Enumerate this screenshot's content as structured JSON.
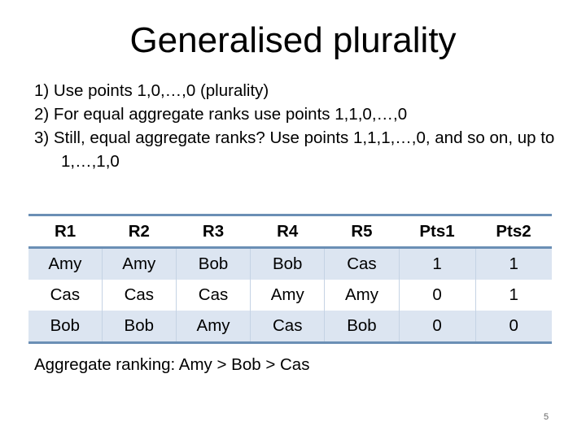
{
  "slide": {
    "title": "Generalised plurality",
    "bullets": [
      "1) Use points 1,0,…,0 (plurality)",
      "2) For equal aggregate ranks use points 1,1,0,…,0",
      "3) Still, equal aggregate ranks? Use points 1,1,1,…,0, and so on, up to 1,…,1,0"
    ],
    "table": {
      "headers": [
        "R1",
        "R2",
        "R3",
        "R4",
        "R5",
        "Pts1",
        "Pts2"
      ],
      "rows": [
        [
          "Amy",
          "Amy",
          "Bob",
          "Bob",
          "Cas",
          "1",
          "1"
        ],
        [
          "Cas",
          "Cas",
          "Cas",
          "Amy",
          "Amy",
          "0",
          "1"
        ],
        [
          "Bob",
          "Bob",
          "Amy",
          "Cas",
          "Bob",
          "0",
          "0"
        ]
      ]
    },
    "aggregate": "Aggregate ranking: Amy > Bob > Cas",
    "page_number": "5"
  }
}
